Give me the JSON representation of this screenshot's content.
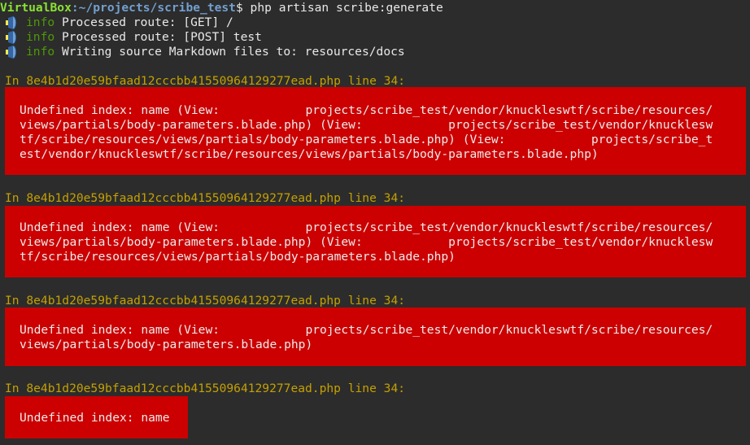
{
  "prompt": {
    "user_host": "VirtualBox",
    "path_prefix": ":",
    "path": "~/projects/scribe_test",
    "symbol": "$",
    "command": " php artisan scribe:generate"
  },
  "info_lines": [
    {
      "label": "info",
      "text": " Processed route: [GET] /"
    },
    {
      "label": "info",
      "text": " Processed route: [POST] test"
    },
    {
      "label": "info",
      "text": " Writing source Markdown files to: resources/docs"
    }
  ],
  "errors": [
    {
      "location": "In 8e4b1d20e59bfaad12cccbb41550964129277ead.php line 34:",
      "lines": [
        "Undefined index: name (View:            projects/scribe_test/vendor/knuckleswtf/scribe/resources/",
        "views/partials/body-parameters.blade.php) (View:            projects/scribe_test/vendor/knucklesw",
        "tf/scribe/resources/views/partials/body-parameters.blade.php) (View:            projects/scribe_t",
        "est/vendor/knuckleswtf/scribe/resources/views/partials/body-parameters.blade.php)"
      ]
    },
    {
      "location": "In 8e4b1d20e59bfaad12cccbb41550964129277ead.php line 34:",
      "lines": [
        "Undefined index: name (View:            projects/scribe_test/vendor/knuckleswtf/scribe/resources/",
        "views/partials/body-parameters.blade.php) (View:            projects/scribe_test/vendor/knucklesw",
        "tf/scribe/resources/views/partials/body-parameters.blade.php)"
      ]
    },
    {
      "location": "In 8e4b1d20e59bfaad12cccbb41550964129277ead.php line 34:",
      "lines": [
        "Undefined index: name (View:            projects/scribe_test/vendor/knuckleswtf/scribe/resources/",
        "views/partials/body-parameters.blade.php)"
      ]
    },
    {
      "location": "In 8e4b1d20e59bfaad12cccbb41550964129277ead.php line 34:",
      "lines": [
        "Undefined index: name"
      ]
    }
  ],
  "colors": {
    "background": "#2c2c2c",
    "error_background": "#cc0000",
    "location_text": "#c4a000",
    "info_label": "#4e9a06",
    "prompt_user": "#8ae234",
    "prompt_path": "#729fcf"
  }
}
